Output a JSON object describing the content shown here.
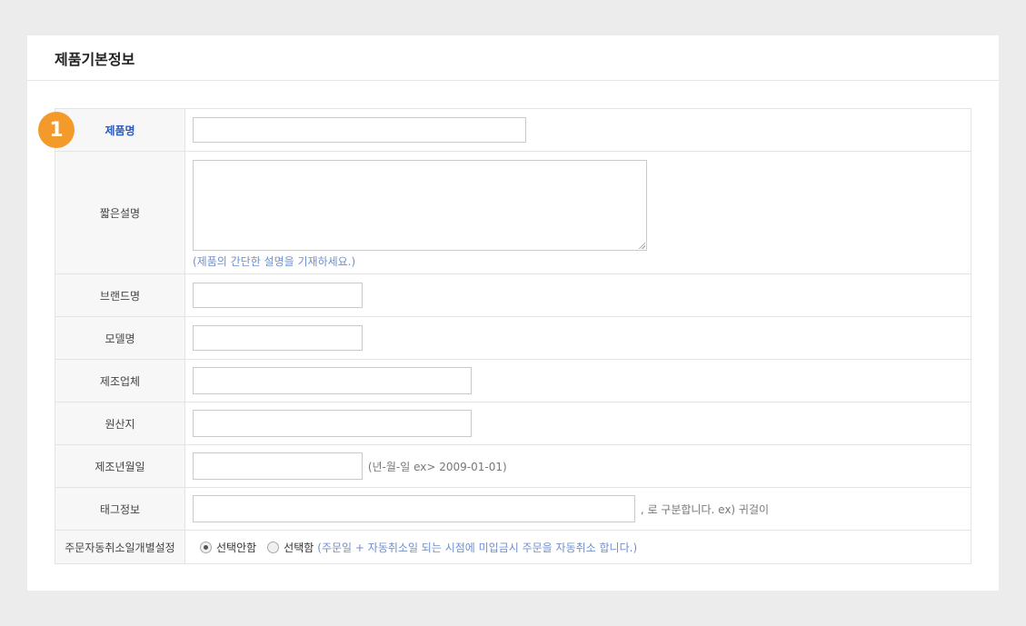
{
  "section": {
    "title": "제품기본정보",
    "step_number": "1"
  },
  "fields": {
    "product_name": {
      "label": "제품명",
      "value": ""
    },
    "short_desc": {
      "label": "짧은설명",
      "value": "",
      "hint": "(제품의 간단한 설명을 기재하세요.)"
    },
    "brand": {
      "label": "브랜드명",
      "value": ""
    },
    "model": {
      "label": "모델명",
      "value": ""
    },
    "manufacturer": {
      "label": "제조업체",
      "value": ""
    },
    "origin": {
      "label": "원산지",
      "value": ""
    },
    "mfg_date": {
      "label": "제조년월일",
      "value": "",
      "hint": "(년-월-일 ex> 2009-01-01)"
    },
    "tags": {
      "label": "태그정보",
      "value": "",
      "hint": ", 로 구분합니다. ex) 귀걸이"
    },
    "auto_cancel": {
      "label": "주문자동취소일개별설정",
      "options": [
        "선택안함",
        "선택함"
      ],
      "selected": "선택안함",
      "hint": "(주문일 + 자동취소일 되는 시점에 미입금시 주문을 자동취소 합니다.)"
    }
  },
  "colors": {
    "accent": "#f39a2b",
    "required_label": "#2b59b8",
    "hint": "#6f8fcf"
  }
}
